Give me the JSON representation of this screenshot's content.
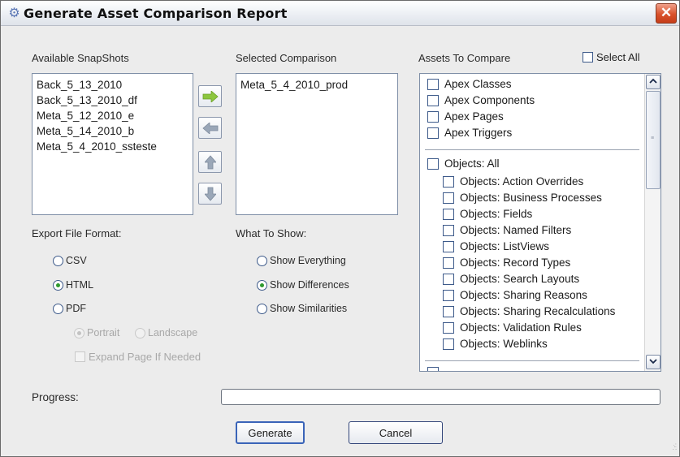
{
  "window": {
    "title": "Generate Asset Comparison Report",
    "close_symbol": "✕"
  },
  "snapshots": {
    "label": "Available SnapShots",
    "items": [
      "Back_5_13_2010",
      "Back_5_13_2010_df",
      "Meta_5_12_2010_e",
      "Meta_5_14_2010_b",
      "Meta_5_4_2010_ssteste"
    ]
  },
  "selected": {
    "label": "Selected Comparison",
    "items": [
      "Meta_5_4_2010_prod"
    ]
  },
  "arrows": {
    "icons": [
      "arrow-right-icon",
      "arrow-left-icon",
      "arrow-up-icon",
      "arrow-down-icon"
    ],
    "colors": {
      "active": "#8cc63f",
      "inactive": "#9aa7b8"
    }
  },
  "assets": {
    "label": "Assets To Compare",
    "select_all_label": "Select All",
    "group1": [
      "Apex Classes",
      "Apex Components",
      "Apex Pages",
      "Apex Triggers"
    ],
    "objects_all": "Objects: All",
    "objects_items": [
      "Objects: Action Overrides",
      "Objects: Business Processes",
      "Objects: Fields",
      "Objects: Named Filters",
      "Objects: ListViews",
      "Objects: Record Types",
      "Objects: Search Layouts",
      "Objects: Sharing Reasons",
      "Objects: Sharing Recalculations",
      "Objects: Validation Rules",
      "Objects: Weblinks"
    ]
  },
  "export": {
    "label": "Export File Format:",
    "options": [
      "CSV",
      "HTML",
      "PDF"
    ],
    "selected": "HTML",
    "pdf_orientation": [
      "Portrait",
      "Landscape"
    ],
    "expand_label": "Expand Page If Needed"
  },
  "show": {
    "label": "What To Show:",
    "options": [
      "Show Everything",
      "Show Differences",
      "Show Similarities"
    ],
    "selected": "Show Differences"
  },
  "progress": {
    "label": "Progress:",
    "value": 0
  },
  "buttons": {
    "generate": "Generate",
    "cancel": "Cancel"
  }
}
